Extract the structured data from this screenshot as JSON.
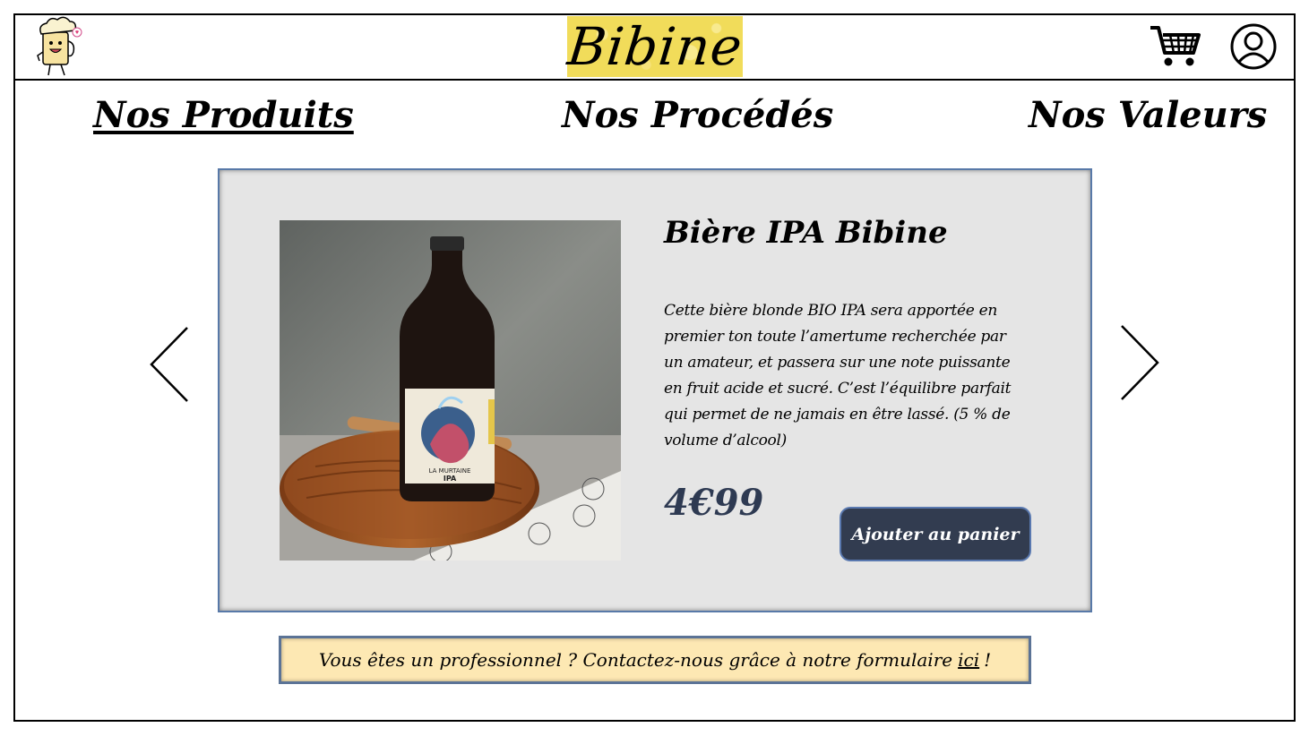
{
  "header": {
    "logo_text": "Bibine",
    "mascot_icon": "beer-mascot-icon",
    "cart_icon": "shopping-cart-icon",
    "account_icon": "user-account-icon"
  },
  "nav": {
    "items": [
      {
        "label": "Nos Produits",
        "active": true
      },
      {
        "label": "Nos Procédés",
        "active": false
      },
      {
        "label": "Nos Valeurs",
        "active": false
      }
    ]
  },
  "product": {
    "title": "Bière IPA Bibine",
    "description": "Cette bière blonde BIO IPA sera apportée en premier ton toute l’amertume recherchée par un amateur, et passera sur une note puissante en fruit acide et sucré. C’est l’équilibre parfait qui permet de ne jamais en être lassé. (5 % de volume d’alcool)",
    "price": "4€99",
    "add_to_cart_label": "Ajouter au panier",
    "label_text_brand": "LA MURTAINE",
    "label_text_style": "IPA"
  },
  "carousel": {
    "prev_icon": "chevron-left-icon",
    "next_icon": "chevron-right-icon"
  },
  "pro_banner": {
    "text": "Vous êtes un professionnel ? Contactez-nous grâce à notre formulaire",
    "link_label": "ici",
    "end": "!"
  },
  "colors": {
    "card_bg": "#e5e5e5",
    "card_border": "#5879a8",
    "button_bg": "#323c50",
    "price": "#2e3a52",
    "banner_bg": "#fde8b3",
    "logo_bg": "#f1dc5a"
  }
}
